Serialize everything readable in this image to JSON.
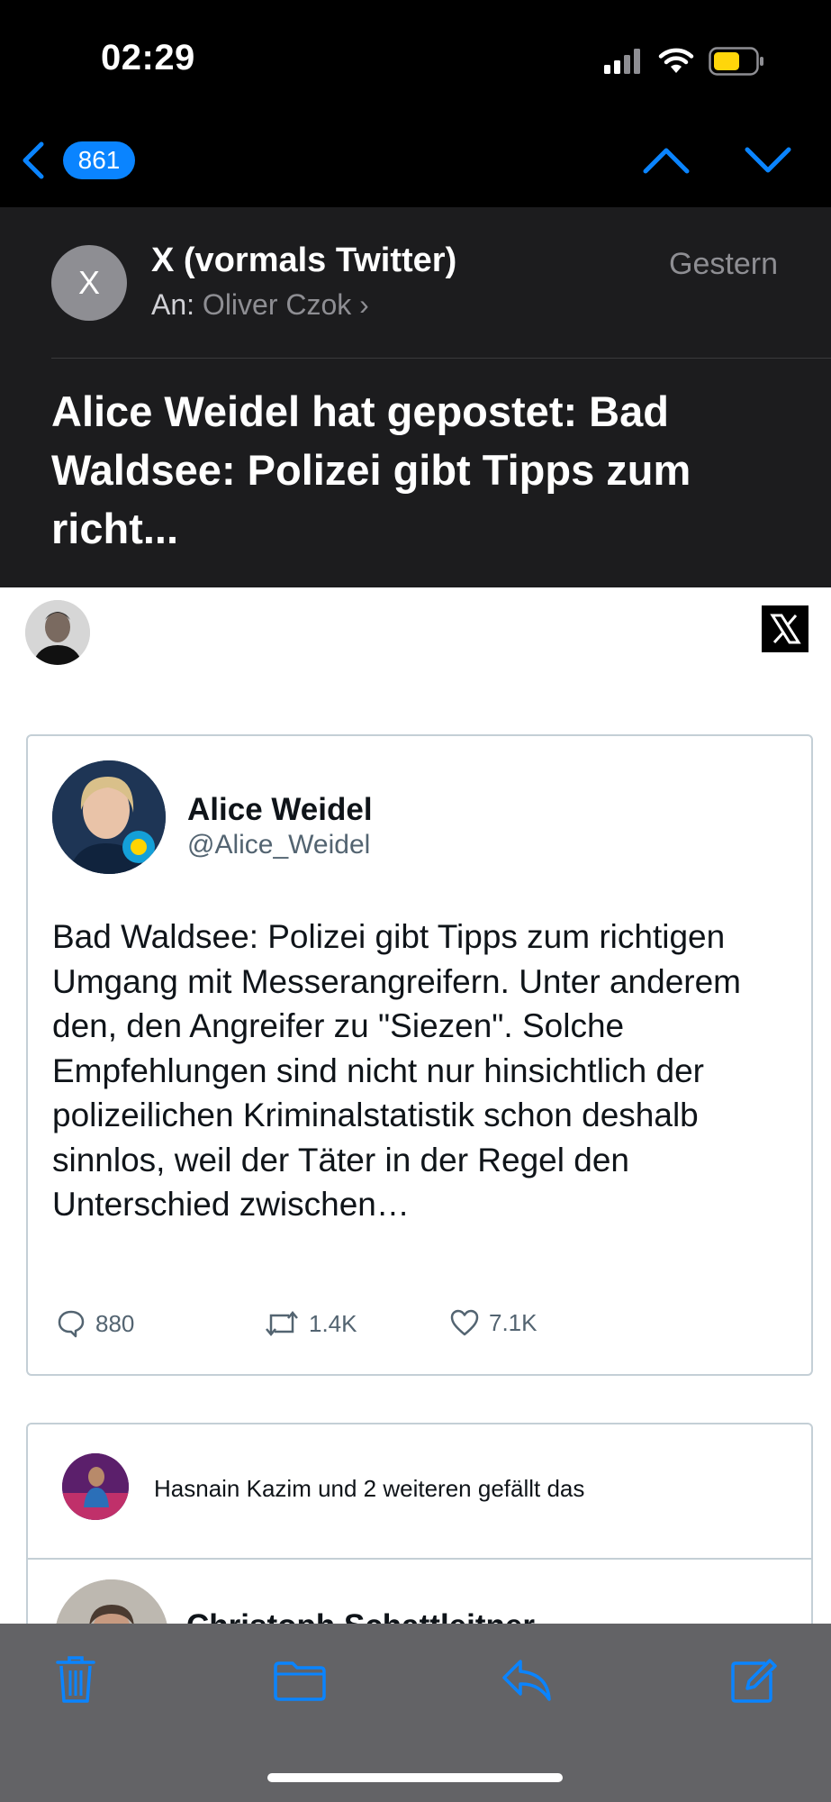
{
  "status_bar": {
    "time": "02:29",
    "icons": [
      "cellular-signal-icon",
      "wifi-icon",
      "battery-icon"
    ],
    "battery_color": "#ffd60a"
  },
  "nav": {
    "back_icon": "chevron-left-icon",
    "unread_count": "861",
    "up_icon": "chevron-up-icon",
    "down_icon": "chevron-down-icon",
    "accent": "#0a84ff"
  },
  "mail": {
    "sender_initial": "X",
    "sender": "X (vormals Twitter)",
    "to_label": "An:",
    "to_name": "Oliver Czok",
    "to_chevron": "›",
    "date": "Gestern",
    "subject": "Alice Weidel hat gepostet: Bad Waldsee: Polizei gibt Tipps zum richt..."
  },
  "tweet": {
    "author": "Alice Weidel",
    "handle": "@Alice_Weidel",
    "text": "Bad Waldsee: Polizei gibt Tipps zum richtigen Umgang mit Messerangreifern. Unter anderem den, den Angreifer zu \"Siezen\". Solche Empfehlungen sind nicht nur hinsichtlich der polizeilichen Kriminalstatistik schon deshalb sinnlos, weil der Täter in der Regel den Unterschied zwischen…",
    "replies": "880",
    "retweets": "1.4K",
    "likes": "7.1K"
  },
  "likes_card": {
    "text": "Hasnain Kazim und 2 weiteren gefällt das",
    "next_author": "Christoph Schattleitner"
  },
  "toolbar": {
    "icons": [
      "trash-icon",
      "folder-icon",
      "reply-icon",
      "compose-icon"
    ],
    "tint": "#0a84ff"
  }
}
